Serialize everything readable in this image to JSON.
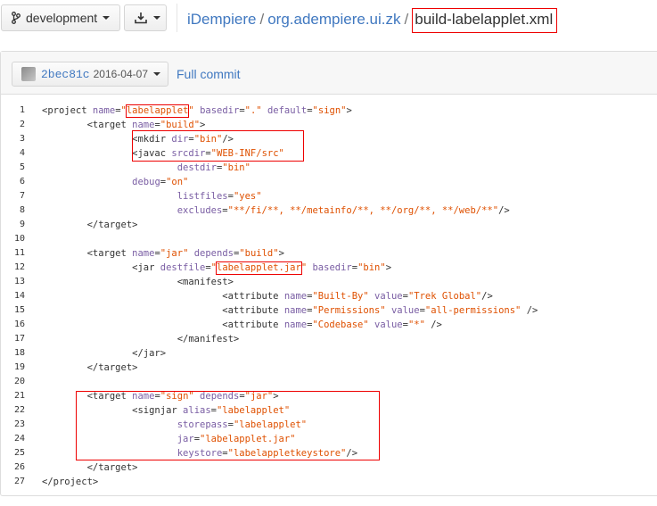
{
  "toolbar": {
    "branch_label": "development",
    "breadcrumb": {
      "repo": "iDempiere",
      "folder": "org.adempiere.ui.zk",
      "file": "build-labelapplet.xml",
      "separator": "/"
    }
  },
  "file_header": {
    "commit_sha": "2bec81c",
    "commit_date": "2016-04-07",
    "full_commit_label": "Full commit"
  },
  "code_lines": [
    {
      "n": "1",
      "text": "<project name=\"labelapplet\" basedir=\".\" default=\"sign\">"
    },
    {
      "n": "2",
      "text": "        <target name=\"build\">"
    },
    {
      "n": "3",
      "text": "                <mkdir dir=\"bin\"/>"
    },
    {
      "n": "4",
      "text": "                <javac srcdir=\"WEB-INF/src\""
    },
    {
      "n": "5",
      "text": "                        destdir=\"bin\""
    },
    {
      "n": "6",
      "text": "                debug=\"on\""
    },
    {
      "n": "7",
      "text": "                        listfiles=\"yes\""
    },
    {
      "n": "8",
      "text": "                        excludes=\"**/fi/**, **/metainfo/**, **/org/**, **/web/**\"/>"
    },
    {
      "n": "9",
      "text": "        </target>"
    },
    {
      "n": "10",
      "text": ""
    },
    {
      "n": "11",
      "text": "        <target name=\"jar\" depends=\"build\">"
    },
    {
      "n": "12",
      "text": "                <jar destfile=\"labelapplet.jar\" basedir=\"bin\">"
    },
    {
      "n": "13",
      "text": "                        <manifest>"
    },
    {
      "n": "14",
      "text": "                                <attribute name=\"Built-By\" value=\"Trek Global\"/>"
    },
    {
      "n": "15",
      "text": "                                <attribute name=\"Permissions\" value=\"all-permissions\" />"
    },
    {
      "n": "16",
      "text": "                                <attribute name=\"Codebase\" value=\"*\" />"
    },
    {
      "n": "17",
      "text": "                        </manifest>"
    },
    {
      "n": "18",
      "text": "                </jar>"
    },
    {
      "n": "19",
      "text": "        </target>"
    },
    {
      "n": "20",
      "text": ""
    },
    {
      "n": "21",
      "text": "        <target name=\"sign\" depends=\"jar\">"
    },
    {
      "n": "22",
      "text": "                <signjar alias=\"labelapplet\""
    },
    {
      "n": "23",
      "text": "                        storepass=\"labelapplet\""
    },
    {
      "n": "24",
      "text": "                        jar=\"labelapplet.jar\""
    },
    {
      "n": "25",
      "text": "                        keystore=\"labelappletkeystore\"/>"
    },
    {
      "n": "26",
      "text": "        </target>"
    },
    {
      "n": "27",
      "text": "</project>"
    }
  ],
  "highlight_color": "#e00000",
  "icons": [
    "branch-icon",
    "download-icon",
    "chevron-down-icon"
  ]
}
